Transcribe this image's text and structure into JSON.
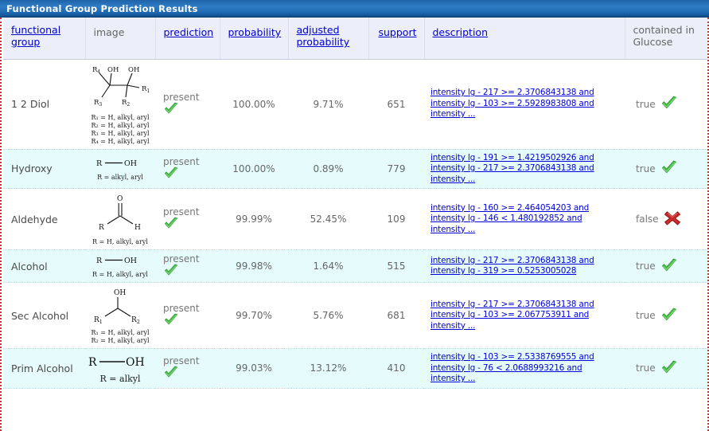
{
  "window": {
    "title": "Functional Group Prediction Results",
    "titlebar_color": "#1f6bb2"
  },
  "table": {
    "columns": [
      {
        "label": "functional group",
        "link": true,
        "name": "functional-group"
      },
      {
        "label": "image",
        "link": false,
        "name": "image"
      },
      {
        "label": "prediction",
        "link": true,
        "name": "prediction"
      },
      {
        "label": "probability",
        "link": true,
        "name": "probability"
      },
      {
        "label": "adjusted probability",
        "link": true,
        "name": "adjusted-probability"
      },
      {
        "label": "support",
        "link": true,
        "name": "support"
      },
      {
        "label": "description",
        "link": true,
        "name": "description"
      },
      {
        "label": "contained in Glucose",
        "link": false,
        "name": "contained-in-glucose"
      }
    ],
    "rows": [
      {
        "group": "1 2 Diol",
        "structure": "diol",
        "structure_legend": [
          "R₁ = H, alkyl, aryl",
          "R₂ = H, alkyl, aryl",
          "R₃ = H, alkyl, aryl",
          "R₄ = H, alkyl, aryl"
        ],
        "prediction": "present",
        "prediction_icon": "green-check-icon",
        "probability": "100.00%",
        "adjusted_probability": "9.71%",
        "support": "651",
        "description": [
          "intensity lg - 217 >= 2.3706843138 and",
          "intensity lg - 103 >= 2.5928983808 and",
          "intensity ..."
        ],
        "contained": "true",
        "contained_icon": "green-check-icon"
      },
      {
        "group": "Hydroxy",
        "structure": "r-oh",
        "structure_legend": [
          "R = alkyl, aryl"
        ],
        "prediction": "present",
        "prediction_icon": "green-check-icon",
        "probability": "100.00%",
        "adjusted_probability": "0.89%",
        "support": "779",
        "description": [
          "intensity lg - 191 >= 1.4219502926 and",
          "intensity lg - 217 >= 2.3706843138 and",
          "intensity ..."
        ],
        "contained": "true",
        "contained_icon": "green-check-icon"
      },
      {
        "group": "Aldehyde",
        "structure": "aldehyde",
        "structure_legend": [
          "R = H, alkyl, aryl"
        ],
        "prediction": "present",
        "prediction_icon": "green-check-icon",
        "probability": "99.99%",
        "adjusted_probability": "52.45%",
        "support": "109",
        "description": [
          "intensity lg - 160 >= 2.464054203 and",
          "intensity lg - 146 < 1.480192852 and",
          "intensity ..."
        ],
        "contained": "false",
        "contained_icon": "red-cross-icon"
      },
      {
        "group": "Alcohol",
        "structure": "r-oh",
        "structure_legend": [
          "R = H, alkyl, aryl"
        ],
        "prediction": "present",
        "prediction_icon": "green-check-icon",
        "probability": "99.98%",
        "adjusted_probability": "1.64%",
        "support": "515",
        "description": [
          "intensity lg - 217 >= 2.3706843138 and",
          "intensity lg - 319 >= 0.5253005028"
        ],
        "contained": "true",
        "contained_icon": "green-check-icon"
      },
      {
        "group": "Sec Alcohol",
        "structure": "sec-alcohol",
        "structure_legend": [
          "R₁ = H, alkyl, aryl",
          "R₂ = H, alkyl, aryl"
        ],
        "prediction": "present",
        "prediction_icon": "green-check-icon",
        "probability": "99.70%",
        "adjusted_probability": "5.76%",
        "support": "681",
        "description": [
          "intensity lg - 217 >= 2.3706843138 and",
          "intensity lg - 103 >= 2.067753911 and",
          "intensity ..."
        ],
        "contained": "true",
        "contained_icon": "green-check-icon"
      },
      {
        "group": "Prim Alcohol",
        "structure": "r-oh-big",
        "structure_legend": [
          "R = alkyl"
        ],
        "prediction": "present",
        "prediction_icon": "green-check-icon",
        "probability": "99.03%",
        "adjusted_probability": "13.12%",
        "support": "410",
        "description": [
          "intensity lg - 103 >= 2.5338769555 and",
          "intensity lg - 76 < 2.0688993216 and",
          "intensity ..."
        ],
        "contained": "true",
        "contained_icon": "green-check-icon"
      }
    ]
  },
  "colors": {
    "check_green": "#3fb33f",
    "cross_red": "#c02020",
    "link_blue": "#0000cc",
    "row_alt": "#e6fbfb",
    "header_bg": "#eceefa",
    "frame_dots": "#d03030"
  }
}
